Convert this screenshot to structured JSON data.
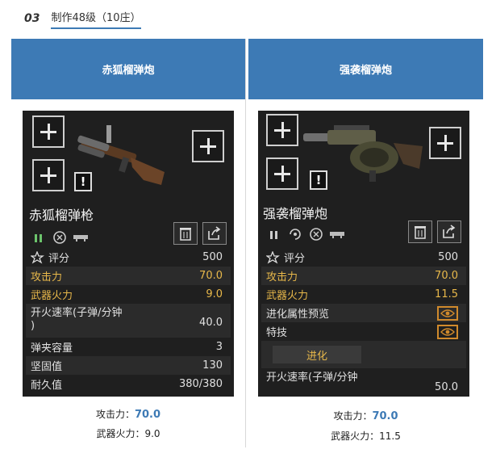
{
  "section": {
    "number": "03",
    "title": "制作48级（10庄）"
  },
  "columns": [
    {
      "header": "赤狐榴弹炮",
      "card": {
        "name": "赤狐榴弹枪",
        "warning": "!",
        "rows": [
          {
            "label": "评分",
            "value": "500"
          },
          {
            "label": "攻击力",
            "value": "70.0"
          },
          {
            "label": "武器火力",
            "value": "9.0"
          },
          {
            "label": "开火速率(子弹/分钟\n)",
            "value": "40.0"
          },
          {
            "label": "弹夹容量",
            "value": "3"
          },
          {
            "label": "坚固值",
            "value": "130"
          },
          {
            "label": "耐久值",
            "value": "380/380"
          }
        ]
      },
      "caption": {
        "attack_label": "攻击力：",
        "attack_value": "70.0",
        "fire_label": "武器火力：",
        "fire_value": "9.0"
      }
    },
    {
      "header": "强袭榴弹炮",
      "card": {
        "name": "强袭榴弹炮",
        "warning": "!",
        "rows": [
          {
            "label": "评分",
            "value": "500"
          },
          {
            "label": "攻击力",
            "value": "70.0"
          },
          {
            "label": "武器火力",
            "value": "11.5"
          },
          {
            "label": "进化属性预览",
            "value": ""
          },
          {
            "label": "特技",
            "value": ""
          },
          {
            "label": "进化",
            "value": ""
          },
          {
            "label": "开火速率(子弹/分钟",
            "value": "50.0"
          }
        ]
      },
      "caption": {
        "attack_label": "攻击力：",
        "attack_value": "70.0",
        "fire_label": "武器火力：",
        "fire_value": "11.5"
      }
    }
  ],
  "colors": {
    "header_blue": "#3d7ab5",
    "card_bg": "#1f1f1f",
    "gold_text": "#e8b84a",
    "eye_orange": "#d08a2c"
  },
  "icons": [
    "plus-icon",
    "warning-icon",
    "trash-icon",
    "share-icon",
    "ammo-icon",
    "reload-icon",
    "rail-icon",
    "score-icon",
    "eye-icon"
  ]
}
